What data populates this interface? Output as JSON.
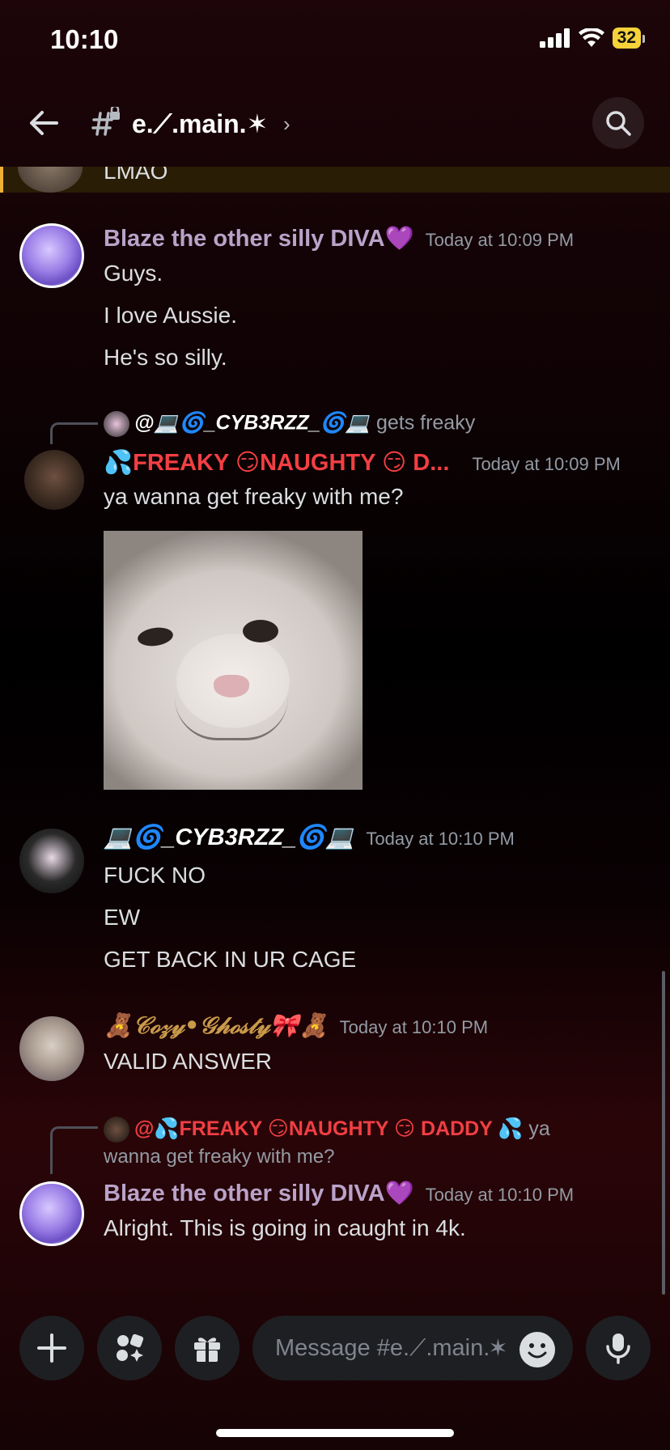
{
  "status_bar": {
    "time": "10:10",
    "battery": "32"
  },
  "header": {
    "channel": "e.⟋.main.✶",
    "chevron": "›"
  },
  "highlight": {
    "text": "LMAO"
  },
  "messages": [
    {
      "author": "Blaze the other silly DIVA💜",
      "timestamp": "Today at 10:09 PM",
      "lines": [
        "Guys.",
        "I love Aussie.",
        "He's so silly."
      ]
    },
    {
      "reply_user": "@💻🌀_CYB3RZZ_🌀💻",
      "reply_text": "gets freaky",
      "author": "💦FREAKY 😏NAUGHTY 😏 D...",
      "timestamp": "Today at 10:09 PM",
      "lines": [
        "ya wanna get freaky with me?"
      ]
    },
    {
      "author": "💻🌀_CYB3RZZ_🌀💻",
      "timestamp": "Today at 10:10 PM",
      "lines": [
        "FUCK NO",
        "EW",
        "GET BACK IN UR CAGE"
      ]
    },
    {
      "author": "🧸𝒞ℴ𝓏𝓎•𝒢𝒽ℴ𝓈𝓉𝓎🎀🧸",
      "timestamp": "Today at 10:10 PM",
      "lines": [
        "VALID ANSWER"
      ]
    },
    {
      "reply_user": "@💦FREAKY 😏NAUGHTY 😏 DADDY 💦",
      "reply_text": "ya",
      "reply_text2": "wanna get freaky with me?",
      "author": "Blaze the other silly DIVA💜",
      "timestamp": "Today at 10:10 PM",
      "lines": [
        "Alright. This is going in caught in 4k."
      ]
    }
  ],
  "composer": {
    "placeholder": "Message #e.⟋.main.✶"
  },
  "colors": {
    "accent_red": "#f23f43",
    "muted": "#949ba4",
    "highlight_bar": "#f0b132"
  }
}
